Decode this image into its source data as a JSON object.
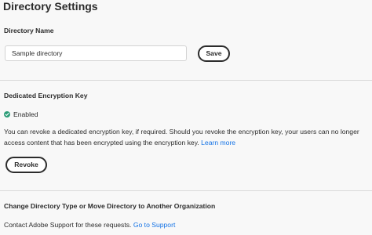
{
  "page": {
    "title": "Directory Settings"
  },
  "directory_name": {
    "label": "Directory Name",
    "input_value": "Sample directory",
    "save_label": "Save"
  },
  "encryption": {
    "label": "Dedicated Encryption Key",
    "status": "Enabled",
    "status_color": "#2d9d78",
    "description_line1": "You can revoke a dedicated encryption key, if required. Should you revoke the encryption key, your users can no longer",
    "description_line2": "access content that has been encrypted using the encryption key.",
    "learn_more": "Learn more",
    "revoke_label": "Revoke"
  },
  "change_directory": {
    "label": "Change Directory Type or Move Directory to Another Organization",
    "description": "Contact Adobe Support for these requests.",
    "support_link": "Go to Support",
    "link_color": "#1473e6"
  }
}
